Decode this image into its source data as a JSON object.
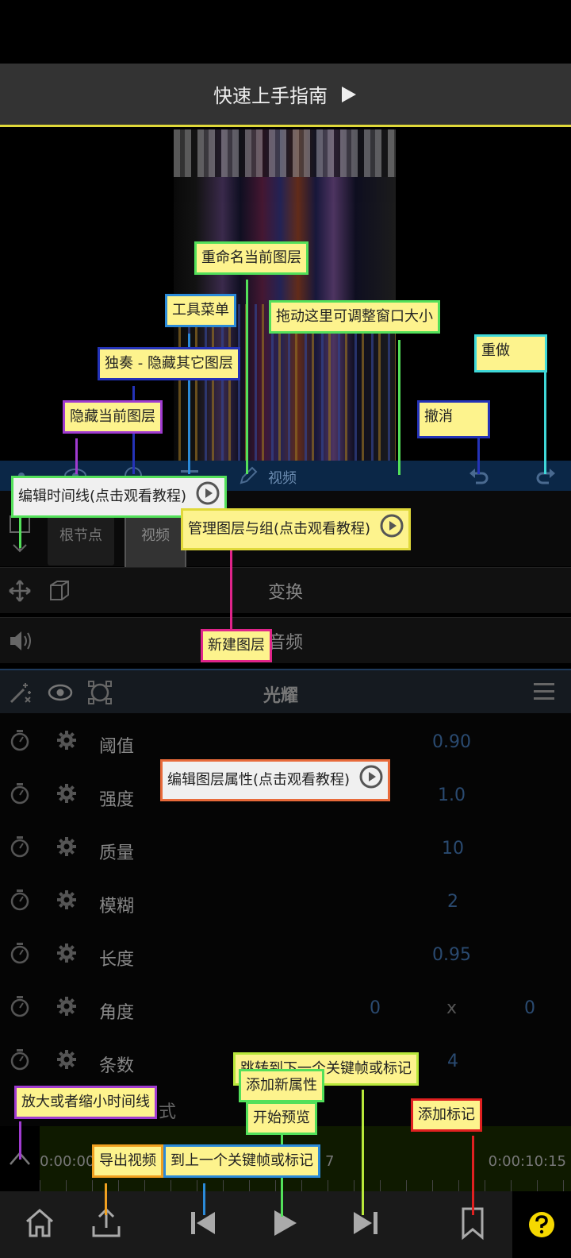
{
  "header": {
    "title": "快速上手指南"
  },
  "layerbar": {
    "layer_name": "视频"
  },
  "tabs": {
    "root": "根节点",
    "video": "视频"
  },
  "rows": {
    "transform": "变换",
    "audio": "音频"
  },
  "effect": {
    "title": "光耀"
  },
  "properties": [
    {
      "name": "阈值",
      "value": "0.90"
    },
    {
      "name": "强度",
      "value": "1.0"
    },
    {
      "name": "质量",
      "value": "10"
    },
    {
      "name": "模糊",
      "value": "2"
    },
    {
      "name": "长度",
      "value": "0.95"
    },
    {
      "name": "角度",
      "value_x": "0",
      "sep": "x",
      "value_y": "0"
    },
    {
      "name": "条数",
      "value": "4"
    }
  ],
  "timeline": {
    "start": "0:00:00",
    "end": "0:00:10:15",
    "partial_label": "式",
    "mid": "7"
  },
  "annotations": {
    "rename_layer": "重命名当前图层",
    "tool_menu": "工具菜单",
    "drag_resize": "拖动这里可调整窗口大小",
    "redo": "重做",
    "solo": "独奏 - 隐藏其它图层",
    "hide_layer": "隐藏当前图层",
    "undo": "撤消",
    "edit_timeline": "编辑时间线(点击观看教程)",
    "manage_layers": "管理图层与组(点击观看教程)",
    "new_layer": "新建图层",
    "edit_props": "编辑图层属性(点击观看教程)",
    "jump_next": "跳转到下一个关键帧或标记",
    "add_prop": "添加新属性",
    "zoom_timeline": "放大或者缩小时间线",
    "start_preview": "开始预览",
    "add_marker": "添加标记",
    "export_video": "导出视频",
    "jump_prev": "到上一个关键帧或标记"
  },
  "colors": {
    "accent_yellow": "#e0d93a",
    "note_bg": "#fdf38d"
  }
}
